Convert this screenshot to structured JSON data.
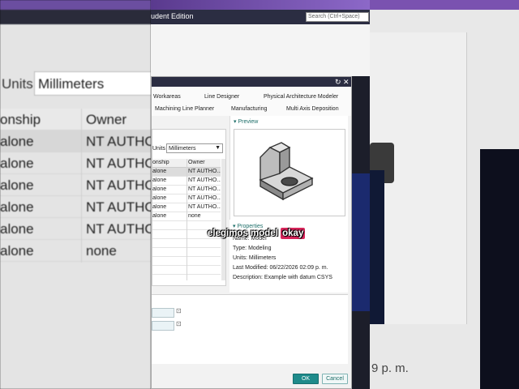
{
  "background": {
    "units_label": "Units",
    "units_value": "Millimeters",
    "col_relationship": "onship",
    "col_owner": "Owner",
    "rows": [
      {
        "rel": "alone",
        "owner": "NT AUTHO"
      },
      {
        "rel": "alone",
        "owner": "NT AUTHO"
      },
      {
        "rel": "alone",
        "owner": "NT AUTHO"
      },
      {
        "rel": "alone",
        "owner": "NT AUTHO"
      },
      {
        "rel": "alone",
        "owner": "NT AUTHO"
      },
      {
        "rel": "alone",
        "owner": "none"
      }
    ],
    "right_text": "9 p. m."
  },
  "app": {
    "title": "udent Edition",
    "search_placeholder": "Search (Ctrl+Space)"
  },
  "dialog": {
    "tabs": [
      "Workareas",
      "Line Designer",
      "Physical Architecture Modeler",
      "Machining Line Planner",
      "Manufacturing",
      "Multi Axis Deposition"
    ],
    "units_label": "Units",
    "units_value": "Millimeters",
    "grid_header": {
      "rel": "onship",
      "owner": "Owner"
    },
    "grid_rows": [
      {
        "rel": "alone",
        "owner": "NT AUTHO..."
      },
      {
        "rel": "alone",
        "owner": "NT AUTHO..."
      },
      {
        "rel": "alone",
        "owner": "NT AUTHO..."
      },
      {
        "rel": "alone",
        "owner": "NT AUTHO..."
      },
      {
        "rel": "alone",
        "owner": "NT AUTHO..."
      },
      {
        "rel": "alone",
        "owner": "none"
      }
    ],
    "preview_label": "Preview",
    "properties_label": "Properties",
    "properties": {
      "name": "Name: Model",
      "type": "Type: Modeling",
      "units": "Units: Millimeters",
      "last_modified": "Last Modified: 06/22/2026 02:09 p. m.",
      "description": "Description: Example with datum CSYS"
    },
    "ok_label": "OK",
    "cancel_label": "Cancel"
  },
  "caption": {
    "text": "elegimos model",
    "highlight": "okay"
  },
  "colors": {
    "accent": "#1f8b8b",
    "caption_highlight": "#d9265c",
    "titlebar": "#2b2d42"
  }
}
